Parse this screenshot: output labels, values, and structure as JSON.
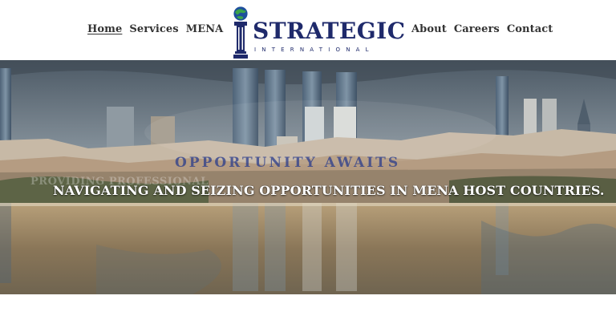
{
  "nav": {
    "left": [
      {
        "label": "Home",
        "active": true
      },
      {
        "label": "Services",
        "active": false
      },
      {
        "label": "MENA",
        "active": false
      }
    ],
    "right": [
      {
        "label": "About",
        "active": false
      },
      {
        "label": "Careers",
        "active": false
      },
      {
        "label": "Contact",
        "active": false
      }
    ]
  },
  "logo": {
    "wordmark": "STRATEGIC",
    "subtitle": "INTERNATIONAL",
    "icons": [
      "globe-icon",
      "pillar-icon"
    ]
  },
  "hero": {
    "small_heading": "OPPORTUNITY AWAITS",
    "ghost_text": "PROVIDING PROFESSIONAL",
    "headline": "NAVIGATING AND SEIZING OPPORTUNITIES IN MENA HOST COUNTRIES."
  },
  "colors": {
    "brand": "#1f2a6b",
    "nav_text": "#333333",
    "hero_heading": "#2a3c8c"
  }
}
